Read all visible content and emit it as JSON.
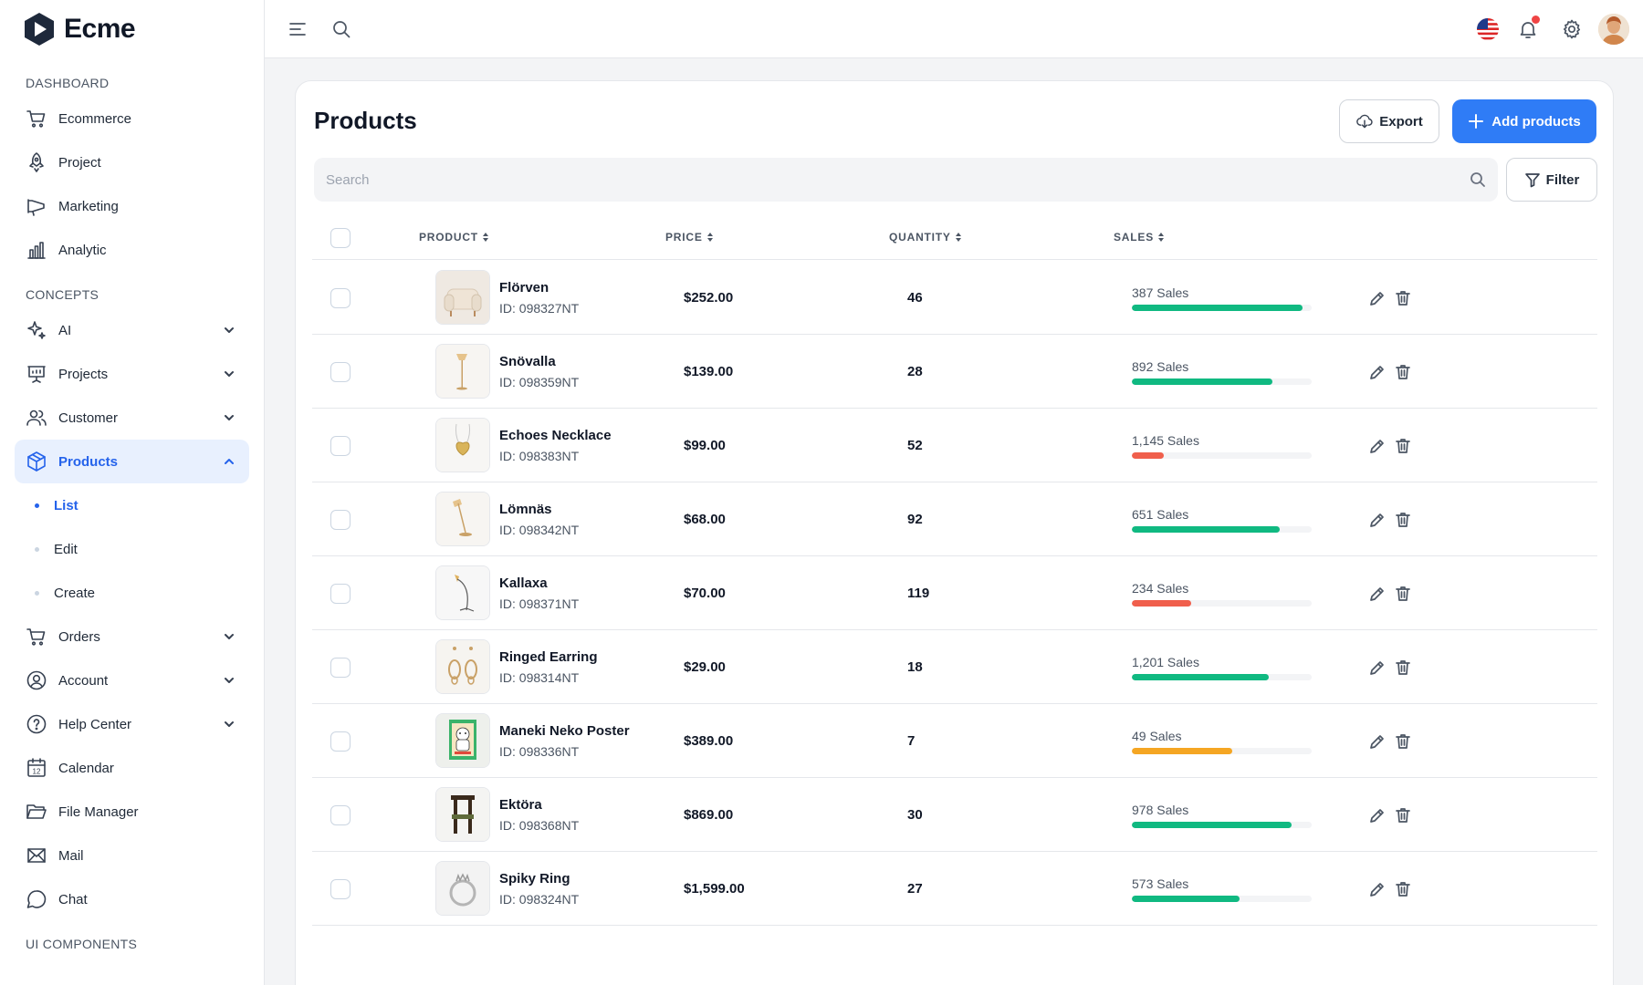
{
  "app": {
    "name": "Ecme"
  },
  "sidebar": {
    "dashboard_title": "DASHBOARD",
    "dashboard_items": [
      {
        "label": "Ecommerce",
        "icon": "cart-icon"
      },
      {
        "label": "Project",
        "icon": "rocket-icon"
      },
      {
        "label": "Marketing",
        "icon": "megaphone-icon"
      },
      {
        "label": "Analytic",
        "icon": "bar-chart-icon"
      }
    ],
    "concepts_title": "CONCEPTS",
    "concepts_items": [
      {
        "label": "AI",
        "icon": "sparkles-icon"
      },
      {
        "label": "Projects",
        "icon": "presentation-icon"
      },
      {
        "label": "Customer",
        "icon": "users-icon"
      },
      {
        "label": "Products",
        "icon": "box-icon",
        "active": true
      },
      {
        "label": "Orders",
        "icon": "cart-icon"
      },
      {
        "label": "Account",
        "icon": "user-circle-icon"
      },
      {
        "label": "Help Center",
        "icon": "help-icon"
      },
      {
        "label": "Calendar",
        "icon": "calendar-icon",
        "badge": "12"
      },
      {
        "label": "File Manager",
        "icon": "folder-icon"
      },
      {
        "label": "Mail",
        "icon": "mail-icon"
      },
      {
        "label": "Chat",
        "icon": "chat-icon"
      }
    ],
    "products_sub": [
      {
        "label": "List",
        "active": true
      },
      {
        "label": "Edit"
      },
      {
        "label": "Create"
      }
    ],
    "ui_components_title": "UI COMPONENTS"
  },
  "header": {
    "icons": [
      "menu-icon",
      "search-icon",
      "flag-us-icon",
      "bell-icon",
      "gear-icon",
      "avatar"
    ],
    "notification_dot_color": "#ef4444"
  },
  "main": {
    "title": "Products",
    "export_label": "Export",
    "add_label": "Add products",
    "search_placeholder": "Search",
    "filter_label": "Filter",
    "columns": [
      "PRODUCT",
      "PRICE",
      "QUANTITY",
      "SALES"
    ]
  },
  "colors": {
    "primary": "#2f7cf6",
    "green": "#10b981",
    "red": "#f05f4c",
    "amber": "#f5a623"
  },
  "products": [
    {
      "name": "Flörven",
      "id": "ID: 098327NT",
      "price": "$252.00",
      "quantity": "46",
      "sales": "387 Sales",
      "progress": 0.95,
      "color": "#10b981",
      "image": "armchair"
    },
    {
      "name": "Snövalla",
      "id": "ID: 098359NT",
      "price": "$139.00",
      "quantity": "28",
      "sales": "892 Sales",
      "progress": 0.78,
      "color": "#10b981",
      "image": "floor-lamp"
    },
    {
      "name": "Echoes Necklace",
      "id": "ID: 098383NT",
      "price": "$99.00",
      "quantity": "52",
      "sales": "1,145 Sales",
      "progress": 0.18,
      "color": "#f05f4c",
      "image": "necklace"
    },
    {
      "name": "Lömnäs",
      "id": "ID: 098342NT",
      "price": "$68.00",
      "quantity": "92",
      "sales": "651 Sales",
      "progress": 0.82,
      "color": "#10b981",
      "image": "lamp"
    },
    {
      "name": "Kallaxa",
      "id": "ID: 098371NT",
      "price": "$70.00",
      "quantity": "119",
      "sales": "234 Sales",
      "progress": 0.33,
      "color": "#f05f4c",
      "image": "arc-lamp"
    },
    {
      "name": "Ringed Earring",
      "id": "ID: 098314NT",
      "price": "$29.00",
      "quantity": "18",
      "sales": "1,201 Sales",
      "progress": 0.76,
      "color": "#10b981",
      "image": "earring"
    },
    {
      "name": "Maneki Neko Poster",
      "id": "ID: 098336NT",
      "price": "$389.00",
      "quantity": "7",
      "sales": "49 Sales",
      "progress": 0.56,
      "color": "#f5a623",
      "image": "poster"
    },
    {
      "name": "Ektöra",
      "id": "ID: 098368NT",
      "price": "$869.00",
      "quantity": "30",
      "sales": "978 Sales",
      "progress": 0.89,
      "color": "#10b981",
      "image": "chair"
    },
    {
      "name": "Spiky Ring",
      "id": "ID: 098324NT",
      "price": "$1,599.00",
      "quantity": "27",
      "sales": "573 Sales",
      "progress": 0.6,
      "color": "#10b981",
      "image": "ring"
    }
  ]
}
